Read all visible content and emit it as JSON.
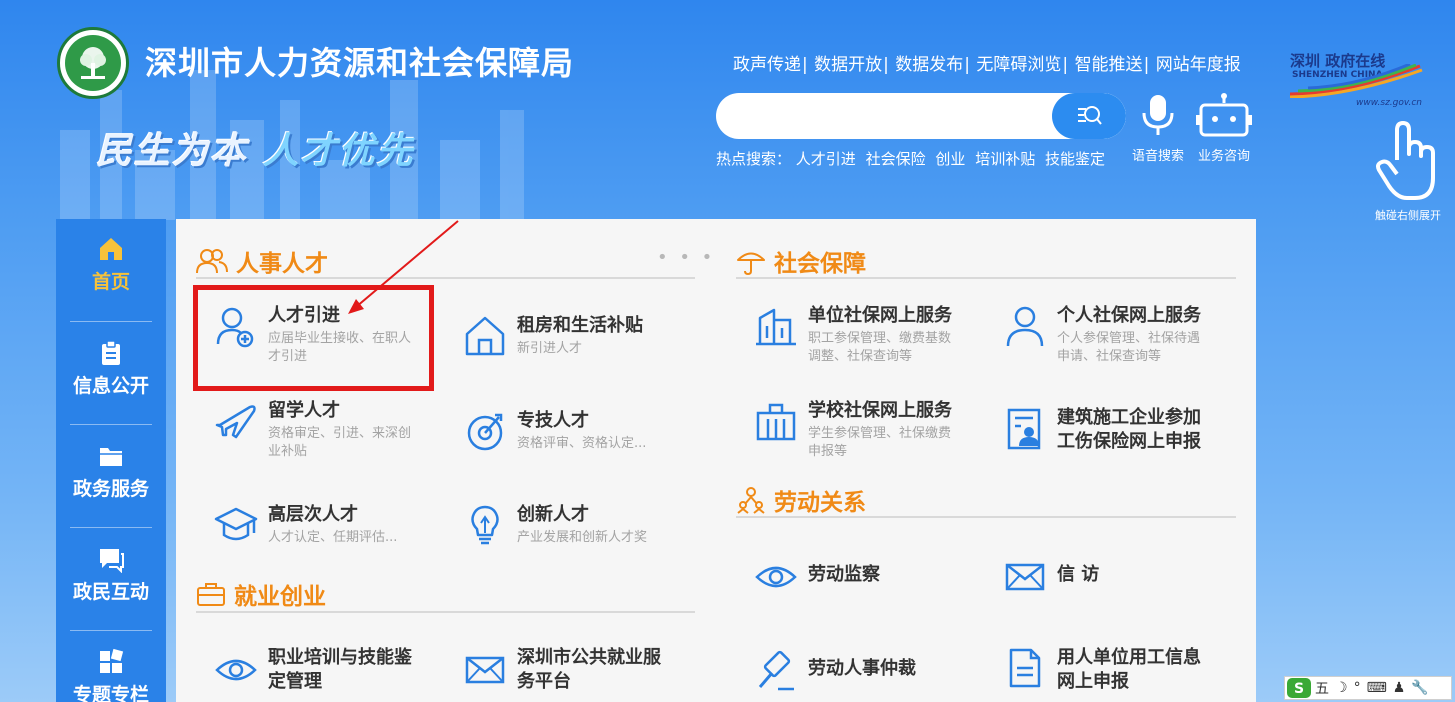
{
  "header": {
    "site_title": "深圳市人力资源和社会保障局",
    "slogan_part1": "民生为本",
    "slogan_part2": "人才优先",
    "top_links": [
      "政声传递",
      "数据开放",
      "数据发布",
      "无障碍浏览",
      "智能推送",
      "网站年度报"
    ],
    "search_placeholder": "",
    "hot_search_label": "热点搜索：",
    "hot_search_items": [
      "人才引进",
      "社会保险",
      "创业",
      "培训补贴",
      "技能鉴定"
    ],
    "voice_search_label": "语音搜索",
    "consult_label": "业务咨询",
    "sz_logo_text": "深圳 政府在线",
    "sz_logo_sub": "SHENZHEN CHINA",
    "sz_logo_url": "www.sz.gov.cn",
    "touch_label": "触碰右侧展开"
  },
  "sidebar": {
    "items": [
      {
        "label": "首页",
        "icon": "home-icon",
        "active": true
      },
      {
        "label": "信息公开",
        "icon": "clipboard-icon"
      },
      {
        "label": "政务服务",
        "icon": "folder-icon"
      },
      {
        "label": "政民互动",
        "icon": "chat-icon"
      },
      {
        "label": "专题专栏",
        "icon": "grid-icon"
      }
    ]
  },
  "sections": {
    "renshi": {
      "title": "人事人才",
      "more": "• • •",
      "items": [
        {
          "title": "人才引进",
          "desc1": "应届毕业生接收、在职人",
          "desc2": "才引进",
          "icon": "user-plus-icon"
        },
        {
          "title": "租房和生活补贴",
          "desc1": "新引进人才",
          "desc2": "",
          "icon": "house-icon"
        },
        {
          "title": "留学人才",
          "desc1": "资格审定、引进、来深创",
          "desc2": "业补贴",
          "icon": "airplane-icon"
        },
        {
          "title": "专技人才",
          "desc1": "资格评审、资格认定...",
          "desc2": "",
          "icon": "target-icon"
        },
        {
          "title": "高层次人才",
          "desc1": "人才认定、任期评估...",
          "desc2": "",
          "icon": "graduation-cap-icon"
        },
        {
          "title": "创新人才",
          "desc1": "产业发展和创新人才奖",
          "desc2": "",
          "icon": "lightbulb-icon"
        }
      ]
    },
    "jiuye": {
      "title": "就业创业",
      "items": [
        {
          "title1": "职业培训与技能鉴",
          "title2": "定管理",
          "icon": "eye-icon"
        },
        {
          "title1": "深圳市公共就业服",
          "title2": "务平台",
          "icon": "envelope-icon"
        }
      ]
    },
    "shebao": {
      "title": "社会保障",
      "items": [
        {
          "title": "单位社保网上服务",
          "desc1": "职工参保管理、缴费基数",
          "desc2": "调整、社保查询等",
          "icon": "building-icon"
        },
        {
          "title": "个人社保网上服务",
          "desc1": "个人参保管理、社保待遇",
          "desc2": "申请、社保查询等",
          "icon": "person-icon"
        },
        {
          "title": "学校社保网上服务",
          "desc1": "学生参保管理、社保缴费",
          "desc2": "申报等",
          "icon": "school-icon"
        },
        {
          "title1": "建筑施工企业参加",
          "title2": "工伤保险网上申报",
          "icon": "worker-card-icon"
        }
      ]
    },
    "laodong": {
      "title": "劳动关系",
      "items": [
        {
          "title": "劳动监察",
          "icon": "eye-icon"
        },
        {
          "title": "信 访",
          "icon": "envelope-icon"
        },
        {
          "title": "劳动人事仲裁",
          "icon": "gavel-icon"
        },
        {
          "title1": "用人单位用工信息",
          "title2": "网上申报",
          "icon": "document-icon"
        }
      ]
    }
  },
  "ime": {
    "mode": "五",
    "items": [
      "☽",
      "°",
      "⌨",
      "♟",
      "🔧"
    ]
  },
  "colors": {
    "accent_orange": "#f08a16",
    "nav_blue": "#2a82e8",
    "icon_blue": "#2a7fe0",
    "highlight_red": "#e21a1a",
    "active_yellow": "#f6c23a"
  }
}
